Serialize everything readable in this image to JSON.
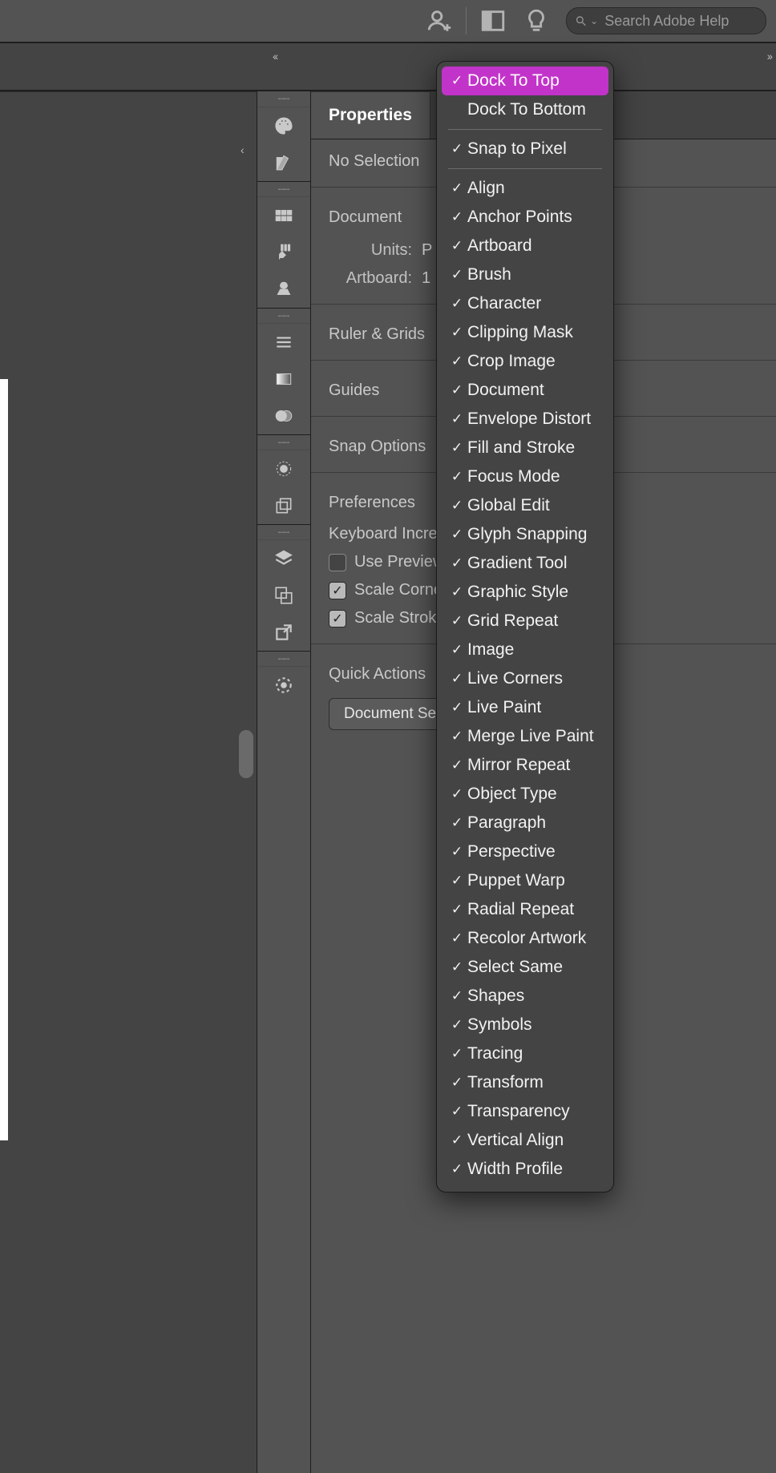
{
  "topbar": {
    "search_placeholder": "Search Adobe Help"
  },
  "workspace": {
    "collapse_arrows": "‹‹",
    "expand_arrows": "››"
  },
  "panel": {
    "tab_title": "Properties",
    "selection_state": "No Selection",
    "document_section": "Document",
    "units_label": "Units:",
    "units_value": "P",
    "artboard_label": "Artboard:",
    "artboard_value": "1",
    "ruler_section": "Ruler & Grids",
    "guides_section": "Guides",
    "snap_section": "Snap Options",
    "prefs_section": "Preferences",
    "kb_increment": "Keyboard Increme",
    "use_preview": "Use Preview B",
    "scale_corners": "Scale Corners",
    "scale_strokes": "Scale Strokes",
    "quick_actions": "Quick Actions",
    "doc_setup_btn": "Document Set"
  },
  "dock_icons": [
    "palette-icon",
    "colorguide-icon",
    "swatches-icon",
    "brushes-icon",
    "symbols-solid-icon",
    "stroke-icon",
    "gradient-icon",
    "transparency-icon",
    "appearance-icon",
    "graphicstyles-icon",
    "layers-icon",
    "artboards-icon",
    "links-icon",
    "asset-export-icon"
  ],
  "menu": {
    "groups": [
      {
        "items": [
          {
            "label": "Dock To Top",
            "checked": true,
            "highlight": true
          },
          {
            "label": "Dock To Bottom",
            "checked": false
          }
        ]
      },
      {
        "items": [
          {
            "label": "Snap to Pixel",
            "checked": true
          }
        ]
      },
      {
        "items": [
          {
            "label": "Align",
            "checked": true
          },
          {
            "label": "Anchor Points",
            "checked": true
          },
          {
            "label": "Artboard",
            "checked": true
          },
          {
            "label": "Brush",
            "checked": true
          },
          {
            "label": "Character",
            "checked": true
          },
          {
            "label": "Clipping Mask",
            "checked": true
          },
          {
            "label": "Crop Image",
            "checked": true
          },
          {
            "label": "Document",
            "checked": true
          },
          {
            "label": "Envelope Distort",
            "checked": true
          },
          {
            "label": "Fill and Stroke",
            "checked": true
          },
          {
            "label": "Focus Mode",
            "checked": true
          },
          {
            "label": "Global Edit",
            "checked": true
          },
          {
            "label": "Glyph Snapping",
            "checked": true
          },
          {
            "label": "Gradient Tool",
            "checked": true
          },
          {
            "label": "Graphic Style",
            "checked": true
          },
          {
            "label": "Grid Repeat",
            "checked": true
          },
          {
            "label": "Image",
            "checked": true
          },
          {
            "label": "Live Corners",
            "checked": true
          },
          {
            "label": "Live Paint",
            "checked": true
          },
          {
            "label": "Merge Live Paint",
            "checked": true
          },
          {
            "label": "Mirror Repeat",
            "checked": true
          },
          {
            "label": "Object Type",
            "checked": true
          },
          {
            "label": "Paragraph",
            "checked": true
          },
          {
            "label": "Perspective",
            "checked": true
          },
          {
            "label": "Puppet Warp",
            "checked": true
          },
          {
            "label": "Radial Repeat",
            "checked": true
          },
          {
            "label": "Recolor Artwork",
            "checked": true
          },
          {
            "label": "Select Same",
            "checked": true
          },
          {
            "label": "Shapes",
            "checked": true
          },
          {
            "label": "Symbols",
            "checked": true
          },
          {
            "label": "Tracing",
            "checked": true
          },
          {
            "label": "Transform",
            "checked": true
          },
          {
            "label": "Transparency",
            "checked": true
          },
          {
            "label": "Vertical Align",
            "checked": true
          },
          {
            "label": "Width Profile",
            "checked": true
          }
        ]
      }
    ]
  }
}
